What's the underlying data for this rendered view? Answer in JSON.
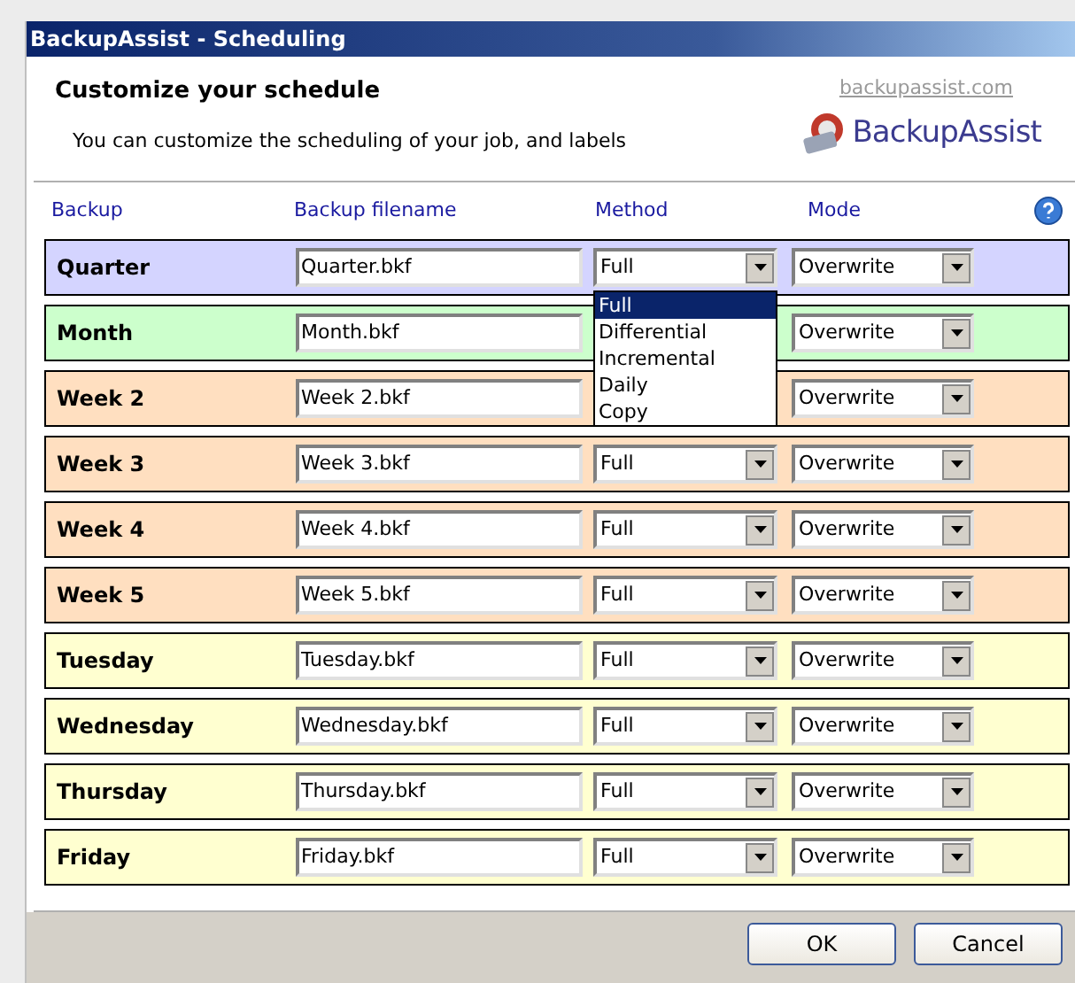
{
  "window": {
    "title": "BackupAssist - Scheduling"
  },
  "header": {
    "title": "Customize your schedule",
    "subtitle": "You can customize the scheduling of your job, and labels",
    "link": "backupassist.com",
    "logo_text": "BackupAssist"
  },
  "columns": [
    "Backup",
    "Backup filename",
    "Method",
    "Mode"
  ],
  "rows": [
    {
      "label": "Quarter",
      "color": "#d4d4ff",
      "filename": "Quarter.bkf",
      "method": "Full",
      "mode": "Overwrite"
    },
    {
      "label": "Month",
      "color": "#ccffcc",
      "filename": "Month.bkf",
      "mode": "Overwrite"
    },
    {
      "label": "Week 2",
      "color": "#ffdfc0",
      "filename": "Week 2.bkf",
      "mode": "Overwrite"
    },
    {
      "label": "Week 3",
      "color": "#ffdfc0",
      "filename": "Week 3.bkf",
      "method": "Full",
      "mode": "Overwrite"
    },
    {
      "label": "Week 4",
      "color": "#ffdfc0",
      "filename": "Week 4.bkf",
      "method": "Full",
      "mode": "Overwrite"
    },
    {
      "label": "Week 5",
      "color": "#ffdfc0",
      "filename": "Week 5.bkf",
      "method": "Full",
      "mode": "Overwrite"
    },
    {
      "label": "Tuesday",
      "color": "#ffffd0",
      "filename": "Tuesday.bkf",
      "method": "Full",
      "mode": "Overwrite"
    },
    {
      "label": "Wednesday",
      "color": "#ffffd0",
      "filename": "Wednesday.bkf",
      "method": "Full",
      "mode": "Overwrite"
    },
    {
      "label": "Thursday",
      "color": "#ffffd0",
      "filename": "Thursday.bkf",
      "method": "Full",
      "mode": "Overwrite"
    },
    {
      "label": "Friday",
      "color": "#ffffd0",
      "filename": "Friday.bkf",
      "method": "Full",
      "mode": "Overwrite"
    }
  ],
  "dropdown": {
    "options": [
      {
        "label": "Full",
        "selected": true
      },
      {
        "label": "Differential",
        "selected": false
      },
      {
        "label": "Incremental",
        "selected": false
      },
      {
        "label": "Daily",
        "selected": false
      },
      {
        "label": "Copy",
        "selected": false
      }
    ]
  },
  "buttons": [
    "OK",
    "Cancel"
  ]
}
